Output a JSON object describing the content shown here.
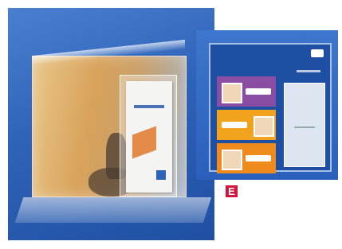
{
  "photos": {
    "left": {
      "subject": "acrylic-brochure-holder-with-poster"
    },
    "right": {
      "subject": "wall-panel-with-brochure-pocket"
    }
  },
  "badge": {
    "letter": "E",
    "color": "#d4143c"
  },
  "colors": {
    "background": "#ffffff",
    "panel_blue": "#1f4fa3"
  }
}
